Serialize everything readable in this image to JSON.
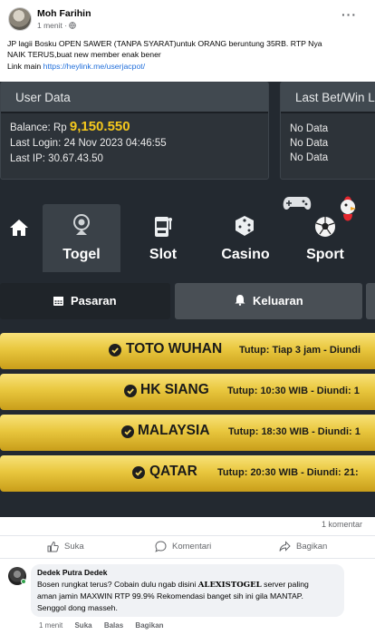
{
  "post": {
    "author": "Moh Farihin",
    "time": "1 menit",
    "globe_icon": "globe-icon",
    "text_line1": "JP lagii Bosku OPEN SAWER (TANPA SYARAT)untuk ORANG beruntung 35RB. RTP Nya",
    "text_line2": "NAIK TERUS,buat new member enak bener",
    "link_prefix": "Link main ",
    "link": "https://heylink.me/userjacpot/"
  },
  "media": {
    "user_data": {
      "title": "User Data",
      "balance_label": "Balance: Rp ",
      "balance_value": "9,150.550",
      "last_login": "Last Login: 24 Nov 2023 04:46:55",
      "last_ip": "Last IP: 30.67.43.50"
    },
    "last_bet": {
      "title": "Last Bet/Win L",
      "rows": [
        "No Data",
        "No Data",
        "No Data"
      ]
    },
    "nav": [
      {
        "label": "",
        "icon": "home-icon"
      },
      {
        "label": "Togel",
        "icon": "lottery-ball-icon"
      },
      {
        "label": "Slot",
        "icon": "slot-machine-icon"
      },
      {
        "label": "Casino",
        "icon": "dice-icon"
      },
      {
        "label": "Sport",
        "icon": "soccer-ball-icon"
      }
    ],
    "subtabs": [
      {
        "label": "Pasaran",
        "icon": "calendar-icon"
      },
      {
        "label": "Keluaran",
        "icon": "bell-icon"
      }
    ],
    "markets": [
      {
        "name": "TOTO WUHAN",
        "info": "Tutup: Tiap 3 jam - Diundi"
      },
      {
        "name": "HK SIANG",
        "info": "Tutup: 10:30 WIB - Diundi: 1"
      },
      {
        "name": "MALAYSIA",
        "info": "Tutup: 18:30 WIB - Diundi: 1"
      },
      {
        "name": "QATAR",
        "info": "Tutup: 20:30 WIB - Diundi: 21:"
      }
    ]
  },
  "stats": {
    "comments": "1 komentar"
  },
  "actions": {
    "like": "Suka",
    "comment": "Komentari",
    "share": "Bagikan"
  },
  "comment": {
    "author": "Dedek Putra Dedek",
    "line1_a": "Bosen rungkat terus? Cobain dulu ngab disini ",
    "line1_brand": "ALEXISTOGEL",
    "line1_b": " server paling",
    "line2": "aman jamin MAXWIN RTP 99.9% Rekomendasi banget sih ini gila MANTAP.",
    "line3": "Senggol dong masseh.",
    "time": "1 menit",
    "like": "Suka",
    "reply": "Balas",
    "share": "Bagikan"
  },
  "colors": {
    "gold": "#f4c81d",
    "link": "#216fdb",
    "dark_bg": "#232930"
  }
}
